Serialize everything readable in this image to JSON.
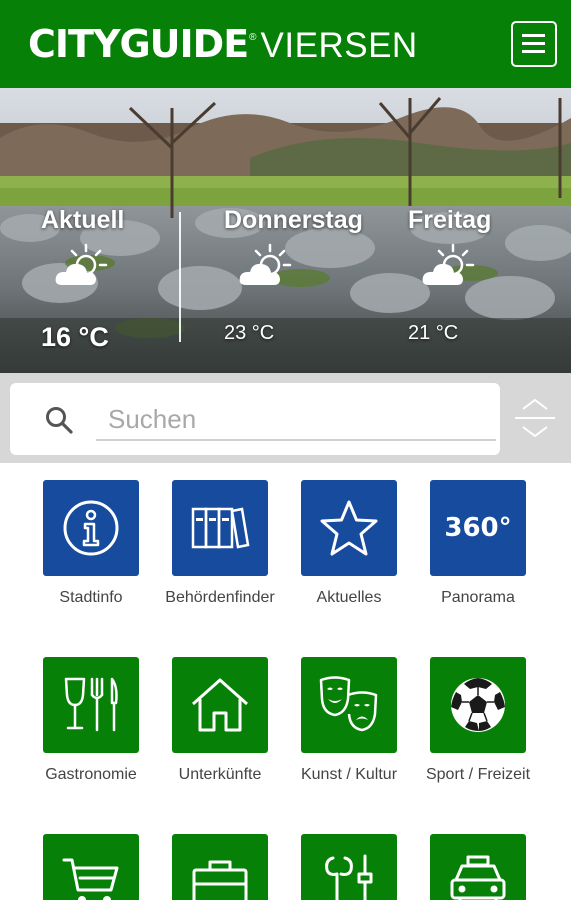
{
  "header": {
    "brand_city": "CITYGUIDE",
    "brand_reg": "®",
    "brand_place": "VIERSEN",
    "menu_icon": "hamburger-menu-icon",
    "color": "#078007"
  },
  "weather": {
    "days": [
      {
        "name": "Aktuell",
        "temp": "16 °C",
        "icon": "partly-cloudy-icon"
      },
      {
        "name": "Donnerstag",
        "temp": "23 °C",
        "icon": "partly-cloudy-icon"
      },
      {
        "name": "Freitag",
        "temp": "21 °C",
        "icon": "partly-cloudy-icon"
      }
    ]
  },
  "search": {
    "placeholder": "Suchen",
    "value": ""
  },
  "tiles": [
    {
      "label": "Stadtinfo",
      "icon": "info-icon",
      "color": "#174b9d"
    },
    {
      "label": "Behördenfinder",
      "icon": "binders-icon",
      "color": "#174b9d"
    },
    {
      "label": "Aktuelles",
      "icon": "star-icon",
      "color": "#174b9d"
    },
    {
      "label": "Panorama",
      "icon": "360-icon",
      "icon_text": "360°",
      "color": "#174b9d"
    },
    {
      "label": "Gastronomie",
      "icon": "dining-icon",
      "color": "#078007"
    },
    {
      "label": "Unterkünfte",
      "icon": "house-icon",
      "color": "#078007"
    },
    {
      "label": "Kunst / Kultur",
      "icon": "theater-masks-icon",
      "color": "#078007"
    },
    {
      "label": "Sport / Freizeit",
      "icon": "soccer-ball-icon",
      "color": "#078007"
    },
    {
      "label": "",
      "icon": "shopping-cart-icon",
      "color": "#078007"
    },
    {
      "label": "",
      "icon": "briefcase-icon",
      "color": "#078007"
    },
    {
      "label": "",
      "icon": "tools-icon",
      "color": "#078007"
    },
    {
      "label": "",
      "icon": "car-icon",
      "color": "#078007"
    }
  ]
}
